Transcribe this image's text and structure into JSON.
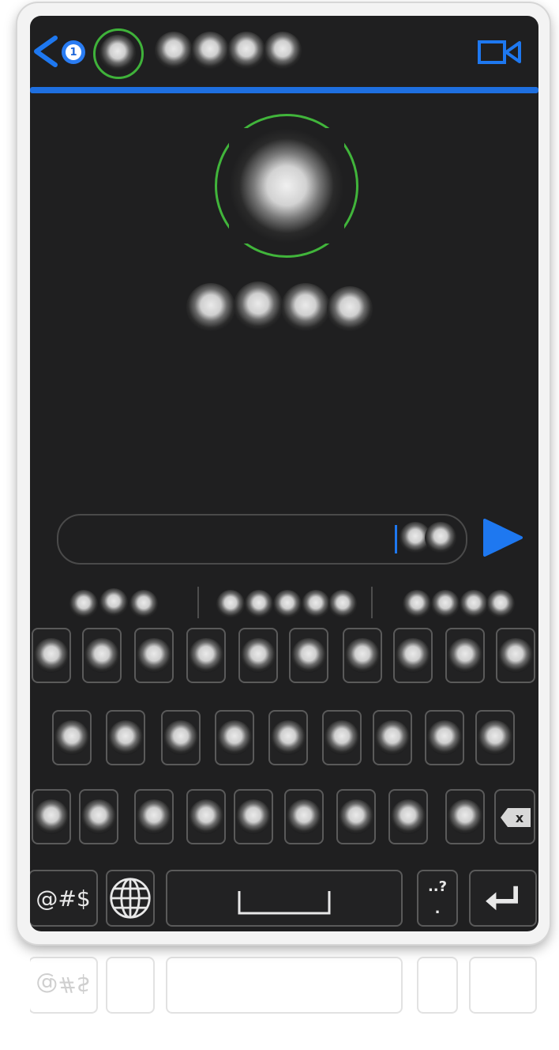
{
  "header": {
    "unread_count": "1",
    "icons": [
      "back-arrow-icon",
      "video-camera-icon"
    ],
    "accent_color": "#1e6fe0",
    "selected_ring_color": "#3fb23a"
  },
  "compose": {
    "input_value": ""
  },
  "keyboard": {
    "symbols_label": "@#$",
    "punct_top": "..?",
    "punct_bottom": "."
  }
}
